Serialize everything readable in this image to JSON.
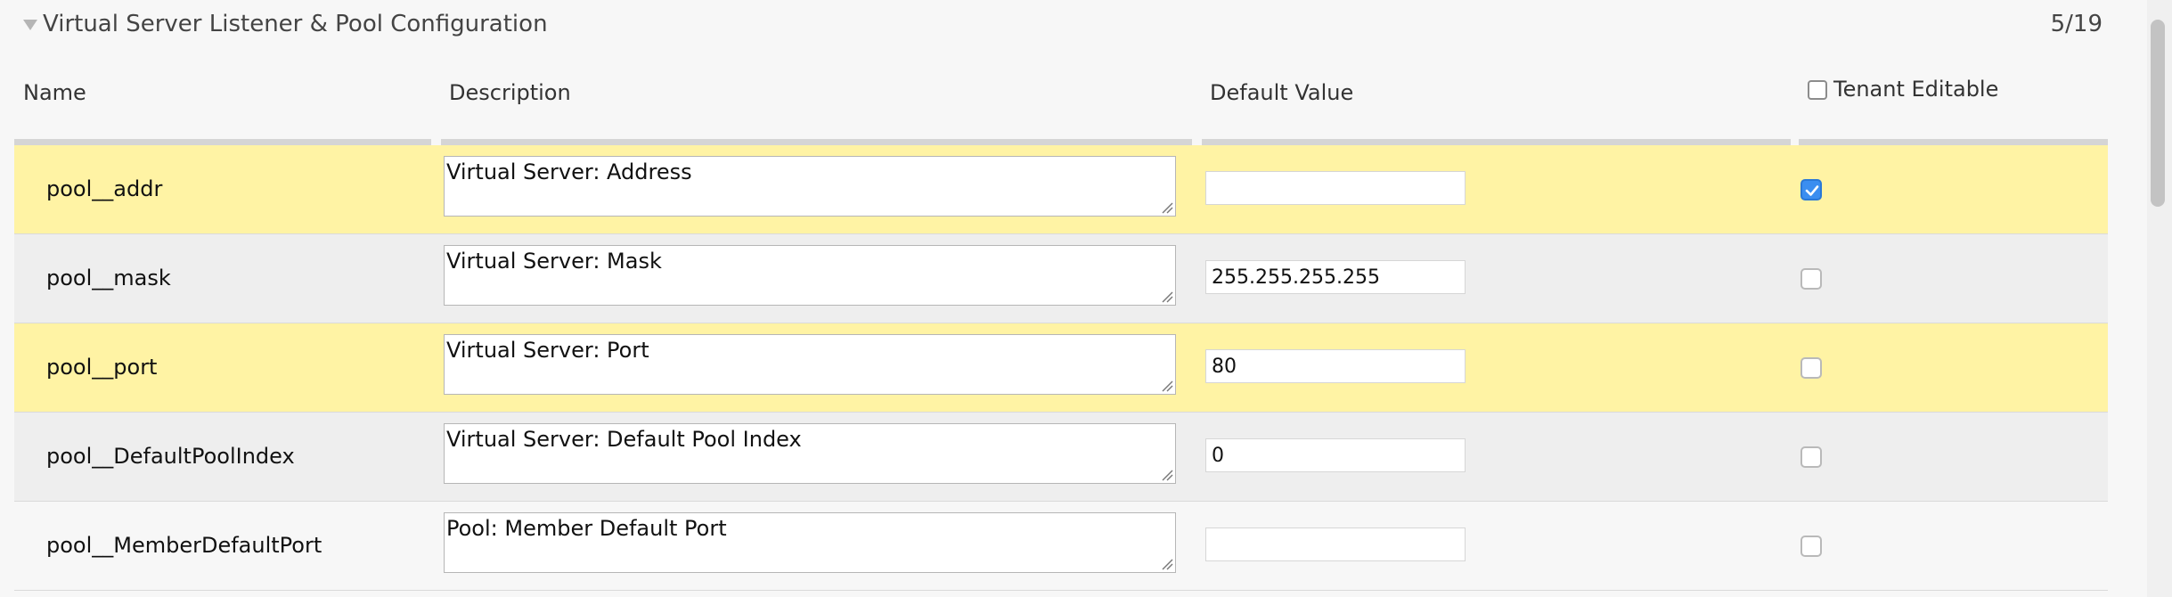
{
  "section": {
    "title": "Virtual Server Listener & Pool Configuration",
    "counter": "5/19"
  },
  "columns": {
    "name": "Name",
    "description": "Description",
    "default_value": "Default Value",
    "tenant_editable": "Tenant Editable"
  },
  "rows": [
    {
      "name": "pool__addr",
      "description": "Virtual Server: Address",
      "default_value": "",
      "tenant_editable": true,
      "highlight": "yellow"
    },
    {
      "name": "pool__mask",
      "description": "Virtual Server: Mask",
      "default_value": "255.255.255.255",
      "tenant_editable": false,
      "highlight": "gray"
    },
    {
      "name": "pool__port",
      "description": "Virtual Server: Port",
      "default_value": "80",
      "tenant_editable": false,
      "highlight": "yellow"
    },
    {
      "name": "pool__DefaultPoolIndex",
      "description": "Virtual Server: Default Pool Index",
      "default_value": "0",
      "tenant_editable": false,
      "highlight": "gray"
    },
    {
      "name": "pool__MemberDefaultPort",
      "description": "Pool: Member Default Port",
      "default_value": "",
      "tenant_editable": false,
      "highlight": "white"
    }
  ],
  "colors": {
    "row_highlight_yellow": "#fff3a4",
    "row_highlight_gray": "#eeeeee",
    "checkbox_checked": "#3b8ef0"
  }
}
